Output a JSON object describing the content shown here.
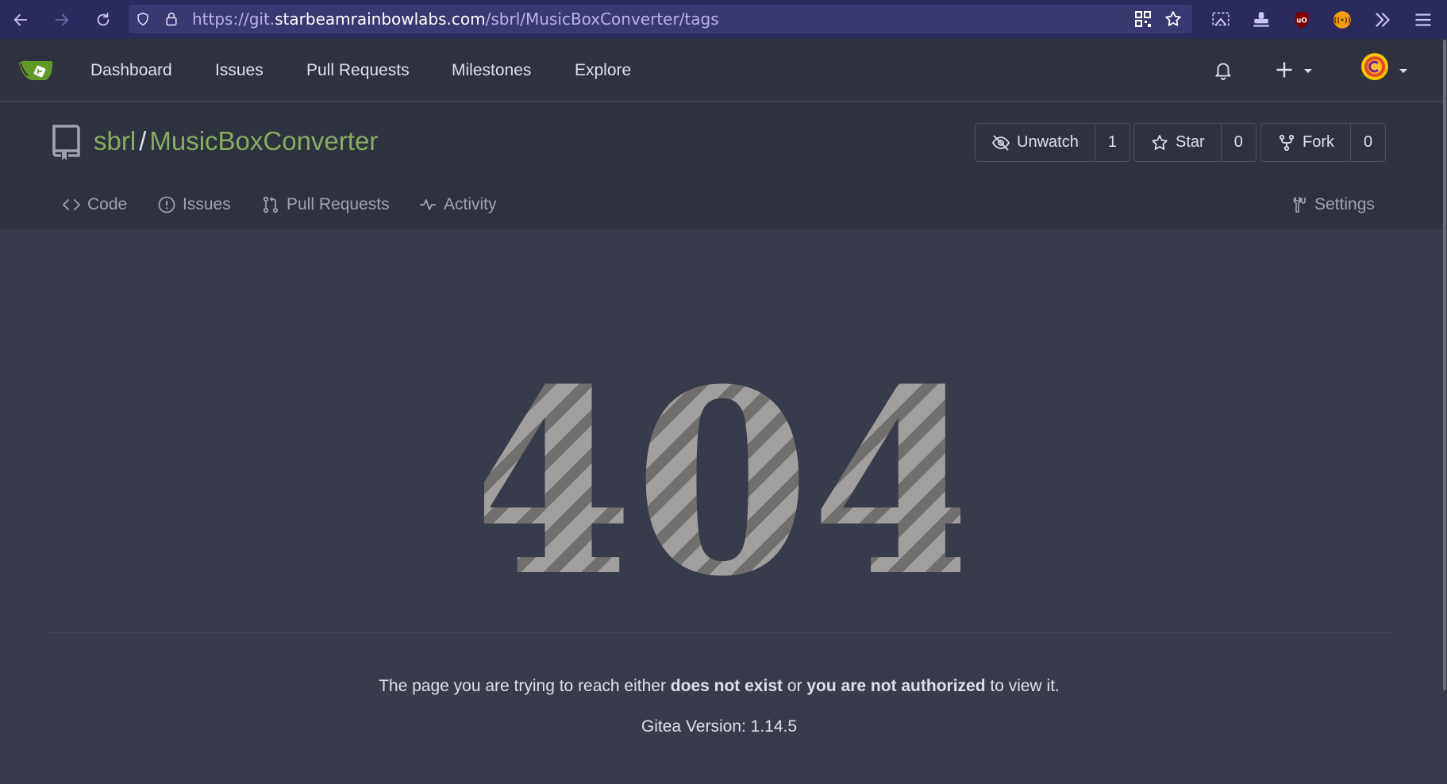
{
  "browser": {
    "url_prefix": "https://git.",
    "url_host": "starbeamrainbowlabs.com",
    "url_path": "/sbrl/MusicBoxConverter/tags"
  },
  "nav": {
    "items": [
      "Dashboard",
      "Issues",
      "Pull Requests",
      "Milestones",
      "Explore"
    ]
  },
  "repo": {
    "owner": "sbrl",
    "separator": "/",
    "name": "MusicBoxConverter",
    "unwatch_label": "Unwatch",
    "watch_count": "1",
    "star_label": "Star",
    "star_count": "0",
    "fork_label": "Fork",
    "fork_count": "0",
    "tabs": {
      "code": "Code",
      "issues": "Issues",
      "pulls": "Pull Requests",
      "activity": "Activity",
      "settings": "Settings"
    }
  },
  "error": {
    "code": "404",
    "msg_before": "The page you are trying to reach either ",
    "msg_bold1": "does not exist",
    "msg_mid": " or ",
    "msg_bold2": "you are not authorized",
    "msg_after": " to view it.",
    "version": "Gitea Version: 1.14.5"
  },
  "colors": {
    "browser_bg": "#2b2a5c",
    "nav_bg": "#2e323e",
    "page_bg": "#383c4a",
    "repo_link": "#87ab63",
    "text": "#dbe0ea"
  }
}
